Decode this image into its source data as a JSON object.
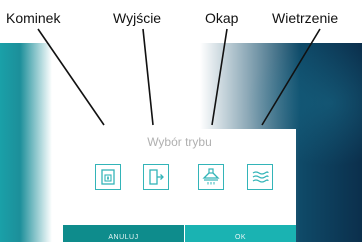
{
  "callouts": {
    "kominek": "Kominek",
    "wyjscie": "Wyjście",
    "okap": "Okap",
    "wietrzenie": "Wietrzenie"
  },
  "dialog": {
    "title": "Wybór trybu",
    "modes": [
      {
        "icon": "fireplace-icon"
      },
      {
        "icon": "exit-door-icon"
      },
      {
        "icon": "cooker-hood-icon"
      },
      {
        "icon": "airflow-waves-icon"
      }
    ],
    "cancel_label": "ANULUJ",
    "ok_label": "OK"
  },
  "colors": {
    "accent": "#1ab3b2",
    "accent_dark": "#0e8c8c",
    "icon_stroke": "#33b4b8"
  }
}
